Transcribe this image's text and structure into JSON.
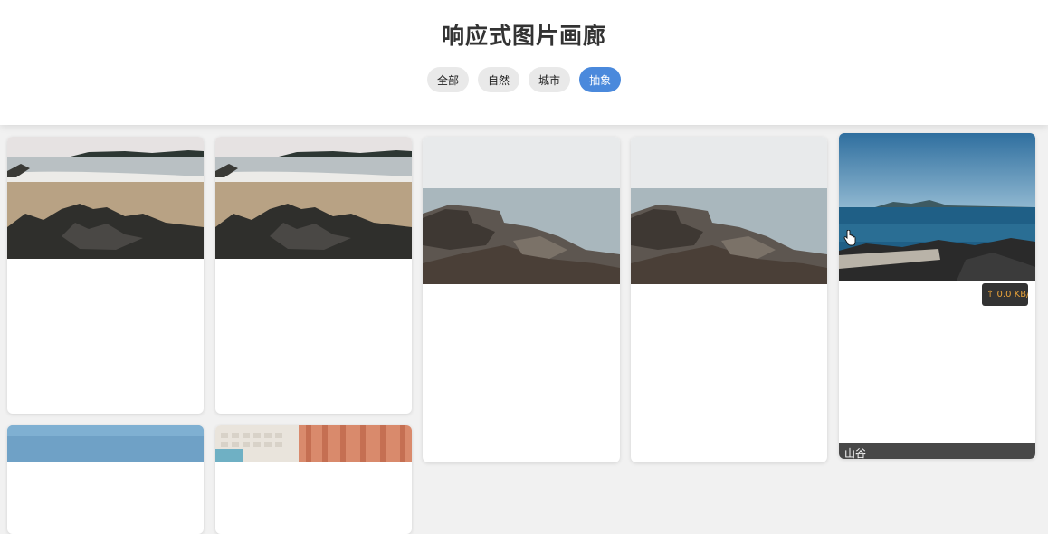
{
  "header": {
    "title": "响应式图片画廊",
    "filters": [
      {
        "label": "全部",
        "active": false
      },
      {
        "label": "自然",
        "active": false
      },
      {
        "label": "城市",
        "active": false
      },
      {
        "label": "抽象",
        "active": true
      }
    ]
  },
  "gallery": {
    "cards": [
      {
        "image": "beach-rocks-photo",
        "caption": ""
      },
      {
        "image": "beach-rocks-photo",
        "caption": ""
      },
      {
        "image": "rocky-shore-photo",
        "caption": ""
      },
      {
        "image": "rocky-shore-photo",
        "caption": ""
      },
      {
        "image": "blue-sea-driftwood-photo",
        "caption": "山谷"
      },
      {
        "image": "sky-photo",
        "caption": ""
      },
      {
        "image": "keyboard-curtain-photo",
        "caption": ""
      }
    ]
  },
  "overlay": {
    "speed": "↑ 0.0 KB/"
  },
  "colors": {
    "accent": "#4a89dc",
    "badge_text": "#e8a23a"
  }
}
